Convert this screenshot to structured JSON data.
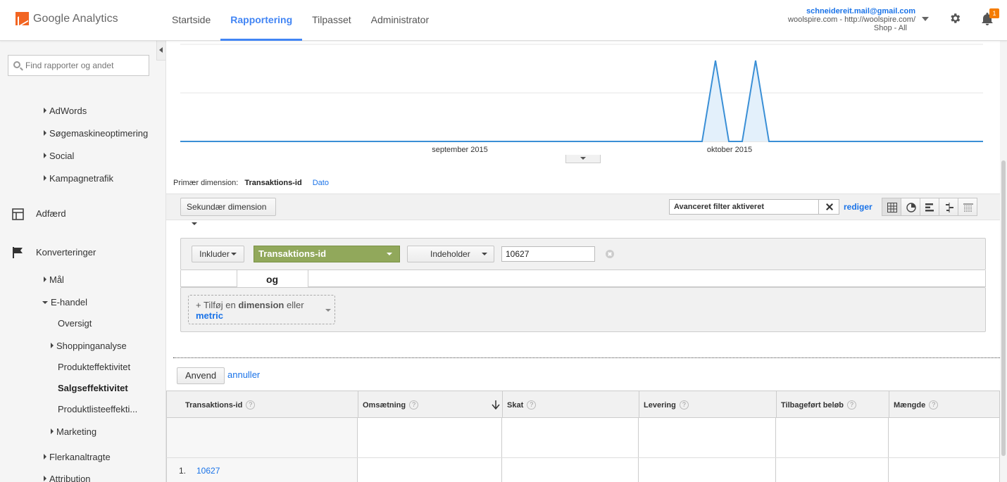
{
  "header": {
    "logo_text": "Google Analytics",
    "nav": [
      "Startside",
      "Rapportering",
      "Tilpasset",
      "Administrator"
    ],
    "active_nav": "Rapportering",
    "account_email": "schneidereit.mail@gmail.com",
    "account_property": "woolspire.com - http://woolspire.com/",
    "account_view": "Shop - All",
    "notification_count": "1"
  },
  "sidebar": {
    "search_placeholder": "Find rapporter og andet",
    "items": {
      "adwords": "AdWords",
      "seo": "Søgemaskineoptimering",
      "social": "Social",
      "kampagne": "Kampagnetrafik",
      "adfaerd": "Adfærd",
      "konverteringer": "Konverteringer",
      "maal": "Mål",
      "ehandel": "E-handel",
      "oversigt": "Oversigt",
      "shopping": "Shoppinganalyse",
      "produkt": "Produkteffektivitet",
      "salg": "Salgseffektivitet",
      "produktliste": "Produktlisteeffekti...",
      "marketing": "Marketing",
      "flerkanal": "Flerkanaltragte",
      "attribution": "Attribution"
    }
  },
  "chart_data": {
    "type": "line",
    "x_ticks": [
      "september 2015",
      "oktober 2015"
    ],
    "series": [
      {
        "values_description_free": true,
        "points": [
          0,
          0,
          0,
          0,
          0,
          0,
          0,
          0,
          0,
          0,
          0,
          0,
          0,
          0,
          0,
          0,
          0,
          0,
          0,
          0,
          0,
          0,
          0,
          0,
          0,
          0,
          0,
          0,
          0,
          0,
          0,
          0,
          0,
          0,
          0,
          0,
          0,
          0,
          0,
          0,
          1,
          0,
          0,
          1,
          0,
          0,
          0,
          0,
          0,
          0,
          0,
          0,
          0,
          0,
          0,
          0,
          0,
          0,
          0,
          0,
          0
        ]
      }
    ],
    "ylim": [
      0,
      1
    ],
    "grid": true
  },
  "report": {
    "primary_dim_label": "Primær dimension:",
    "primary_dim_active": "Transaktions-id",
    "primary_dim_alt": "Dato",
    "secondary_dim": "Sekundær dimension",
    "adv_filter": "Avanceret filter aktiveret",
    "edit": "rediger"
  },
  "filter": {
    "include": "Inkluder",
    "dimension": "Transaktions-id",
    "operator": "Indeholder",
    "value": "10627",
    "and_label": "og",
    "add_prefix": "+ Tilføj en",
    "add_dim": "dimension",
    "add_or": "eller",
    "add_metric": "metric",
    "apply": "Anvend",
    "cancel": "annuller"
  },
  "table": {
    "columns": [
      "Transaktions-id",
      "Omsætning",
      "Skat",
      "Levering",
      "Tilbageført beløb",
      "Mængde"
    ],
    "rows": [
      {
        "index": "1.",
        "id": "10627"
      }
    ]
  }
}
